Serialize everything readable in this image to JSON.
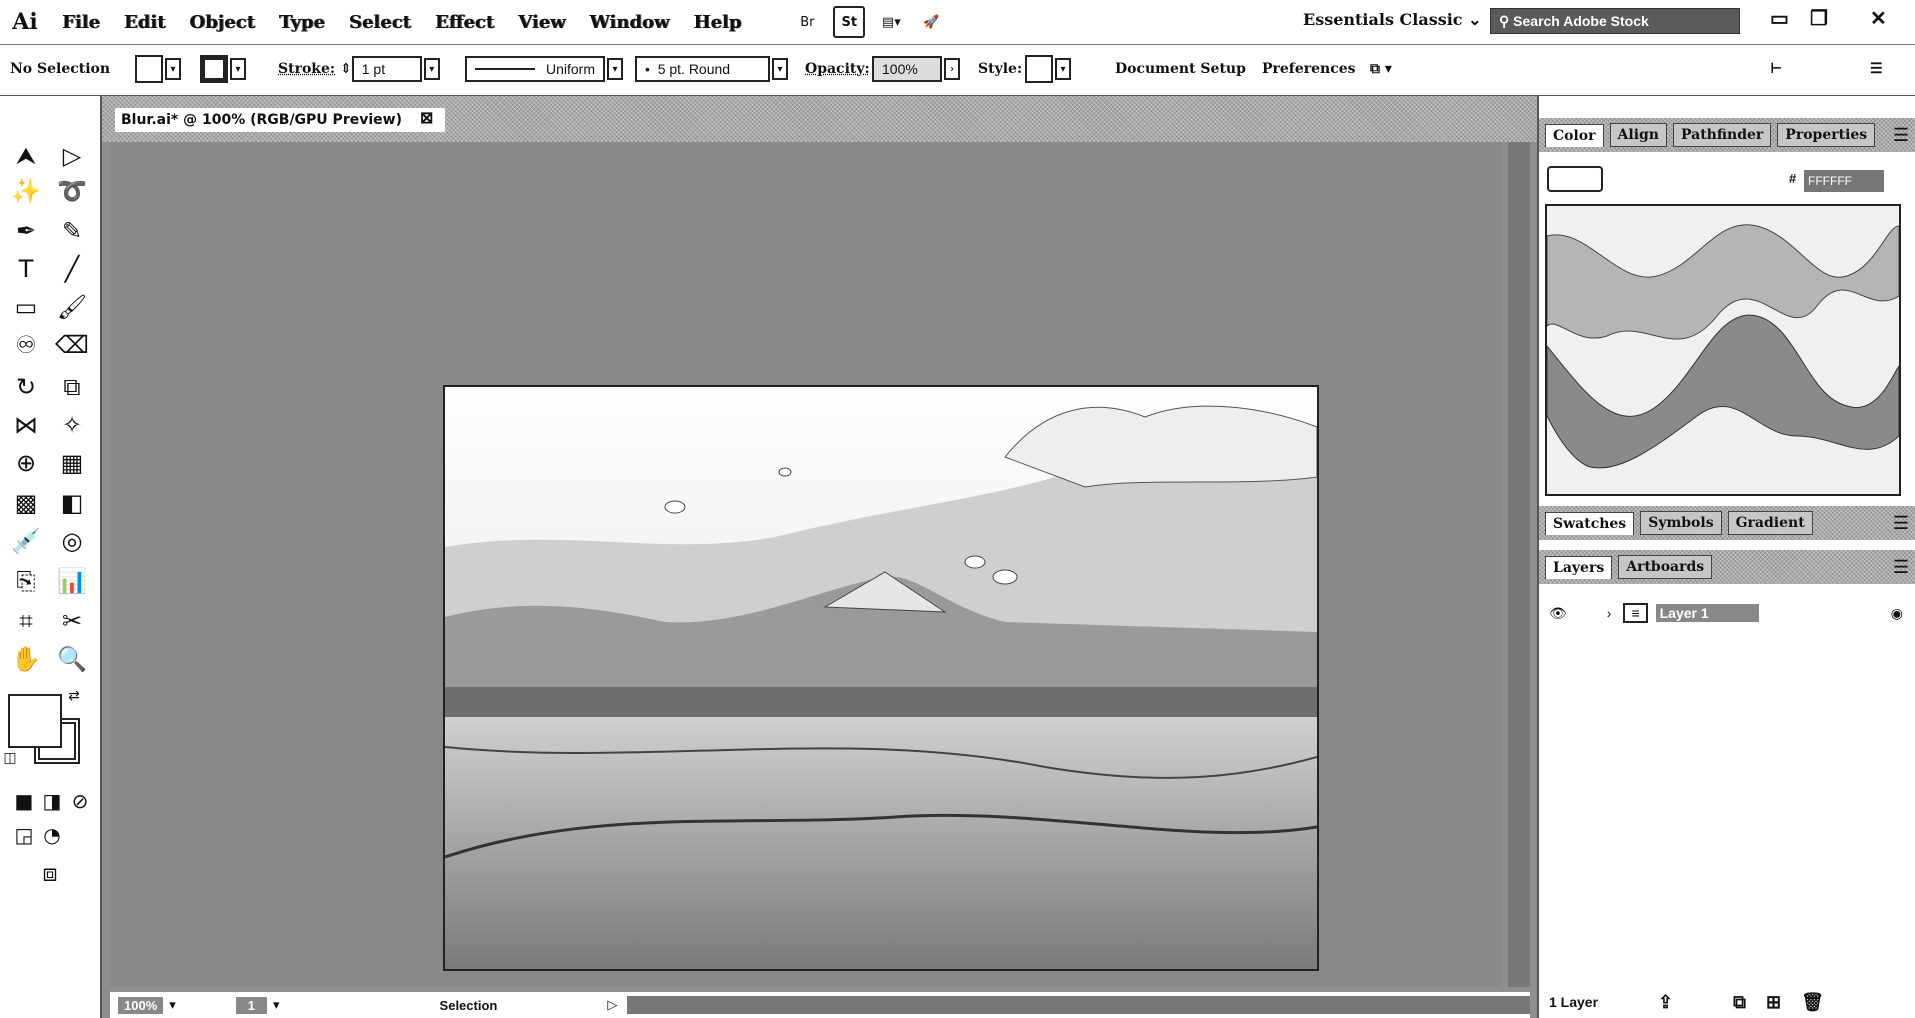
{
  "app": {
    "logo": "Ai"
  },
  "menu": {
    "items": [
      "File",
      "Edit",
      "Object",
      "Type",
      "Select",
      "Effect",
      "View",
      "Window",
      "Help"
    ]
  },
  "topbar": {
    "bridge_label": "Br",
    "stock_label": "St",
    "workspace": "Essentials Classic",
    "search_placeholder": "Search Adobe Stock"
  },
  "control": {
    "selection": "No Selection",
    "stroke_label": "Stroke:",
    "stroke_weight": "1 pt",
    "profile": "Uniform",
    "brush": "5 pt. Round",
    "opacity_label": "Opacity:",
    "opacity_value": "100%",
    "style_label": "Style:",
    "document_setup": "Document Setup",
    "preferences": "Preferences"
  },
  "document": {
    "tab_title": "Blur.ai* @ 100% (RGB/GPU Preview)"
  },
  "panels": {
    "top_tabs": [
      "Color",
      "Align",
      "Pathfinder",
      "Properties"
    ],
    "mid_tabs": [
      "Swatches",
      "Symbols",
      "Gradient"
    ],
    "bottom_tabs": [
      "Layers",
      "Artboards"
    ],
    "hex_label": "#",
    "hex_value": "FFFFFF",
    "layer_name": "Layer 1",
    "layer_count": "1 Layer"
  },
  "status": {
    "zoom": "100%",
    "artboard_index": "1",
    "tool_mode": "Selection"
  },
  "colors": {
    "chrome": "#ffffff",
    "pasteboard": "#898989",
    "artboard": "#ffffff"
  }
}
